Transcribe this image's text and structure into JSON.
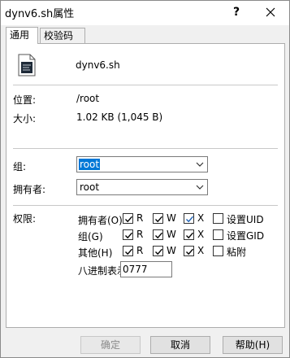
{
  "window": {
    "title": "dynv6.sh属性",
    "help_button": "?",
    "close_button": "X"
  },
  "tabs": [
    {
      "label": "通用",
      "active": true
    },
    {
      "label": "校验码",
      "active": false
    }
  ],
  "general": {
    "file_name": "dynv6.sh",
    "location_label": "位置:",
    "location_value": "/root",
    "size_label": "大小:",
    "size_value": "1.02 KB (1,045 B)",
    "group_label": "组:",
    "group_value": "root",
    "owner_label": "拥有者:",
    "owner_value": "root",
    "permissions_label": "权限:",
    "permissions": {
      "rows": [
        {
          "label": "拥有者(O)",
          "r": true,
          "w": true,
          "x": true,
          "extra_label": "设置UID",
          "extra": false
        },
        {
          "label": "组(G)",
          "r": true,
          "w": true,
          "x": true,
          "extra_label": "设置GID",
          "extra": false
        },
        {
          "label": "其他(H)",
          "r": true,
          "w": true,
          "x": true,
          "extra_label": "粘附",
          "extra": false
        }
      ],
      "r_label": "R",
      "w_label": "W",
      "x_label": "X",
      "octal_label": "八进制表示",
      "octal_value": "0777"
    }
  },
  "buttons": {
    "ok": "确定",
    "cancel": "取消",
    "help": "帮助(H)"
  },
  "colors": {
    "selection": "#0078d7",
    "check": "#000000"
  }
}
